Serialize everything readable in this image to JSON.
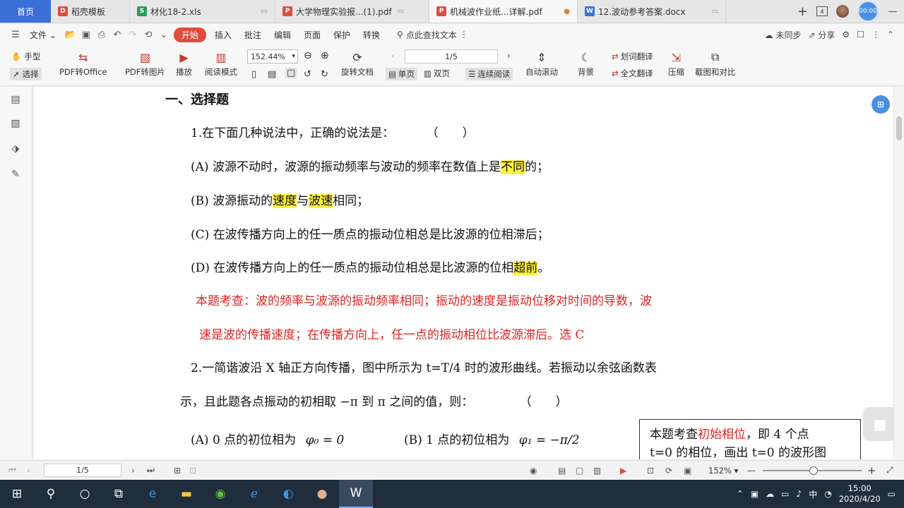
{
  "tabs": {
    "home": "首页",
    "items": [
      {
        "label": "稻壳模板",
        "icon": "docer-icon",
        "color": "#e04c3e"
      },
      {
        "label": "材化18-2.xls",
        "icon": "spreadsheet-icon",
        "color": "#2e9e5b"
      },
      {
        "label": "大学物理实验报...(1).pdf",
        "icon": "pdf-icon",
        "color": "#e04c3e"
      },
      {
        "label": "机械波作业纸...详解.pdf",
        "icon": "pdf-icon",
        "color": "#e04c3e"
      },
      {
        "label": "12.波动参考答案.docx",
        "icon": "word-icon",
        "color": "#3a6fd8"
      }
    ],
    "clock_badge": "00:00",
    "layout_badge": "4"
  },
  "menu": {
    "file": "文件",
    "start": "开始",
    "items": [
      "插入",
      "批注",
      "编辑",
      "页面",
      "保护",
      "转换"
    ],
    "search": "点此查找文本",
    "unsynced": "未同步",
    "share": "分享"
  },
  "ribbon": {
    "hand": "手型",
    "select": "选择",
    "pdf_office": "PDF转Office",
    "pdf_image": "PDF转图片",
    "play": "播放",
    "read_mode": "阅读模式",
    "zoom": "152.44%",
    "rotate": "旋转文档",
    "single": "单页",
    "double": "双页",
    "continuous": "连续阅读",
    "page_indicator": "1/5",
    "auto_scroll": "自动滚动",
    "background": "背景",
    "word_translate": "划词翻译",
    "full_translate": "全文翻译",
    "compress": "压缩",
    "screenshot_compare": "截图和对比"
  },
  "document": {
    "section": "一、选择题",
    "q1": "1.在下面几种说法中，正确的说法是：",
    "q1_paren": "（　　）",
    "a_pre": "(A)  波源不动时，波源的振动频率与波动的频率在数值上是",
    "a_hl": "不同",
    "a_post": "的；",
    "b_pre": "(B)  波源振动的",
    "b_hl1": "速度",
    "b_mid": "与",
    "b_hl2": "波速",
    "b_post": "相同；",
    "c": "(C)  在波传播方向上的任一质点的振动位相总是比波源的位相滞后；",
    "d_pre": "(D)  在波传播方向上的任一质点的振动位相总是比波源的位相",
    "d_hl": "超前",
    "d_post": "。",
    "analysis1": "本题考查：波的频率与波源的振动频率相同；振动的速度是振动位移对时间的导数，波",
    "analysis2": "速是波的传播速度；在传播方向上，任一点的振动相位比波源滞后。选 C",
    "q2_line1": "2.一简谐波沿 X 轴正方向传播，图中所示为 t=T/4 时的波形曲线。若振动以余弦函数表",
    "q2_line2": "示，且此题各点振动的初相取 −π 到 π 之间的值，则：",
    "q2_paren": "（　　）",
    "q2_a_text": "(A) 0 点的初位相为",
    "q2_a_formula": "φ₀ = 0",
    "q2_b_text": "(B) 1 点的初位相为",
    "q2_b_formula": "φ₁ = −π/2",
    "note_line1_pre": "本题考查",
    "note_line1_red": "初始相位",
    "note_line1_post": "，即 4 个点",
    "note_line2": "t=0 的相位，画出 t=0 的波形图"
  },
  "status": {
    "page": "1/5",
    "zoom": "152%"
  },
  "taskbar": {
    "ime": "中",
    "time": "15:00",
    "date": "2020/4/20"
  }
}
